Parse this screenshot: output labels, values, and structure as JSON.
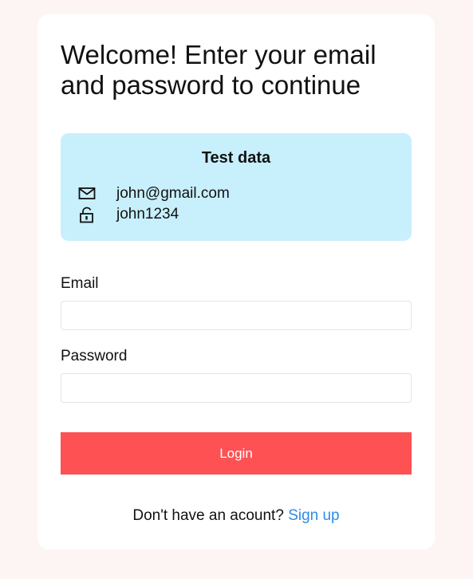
{
  "page": {
    "title": "Welcome! Enter your email and password to continue"
  },
  "test_data": {
    "heading": "Test data",
    "email_icon": "mail-icon",
    "email": "john@gmail.com",
    "password_icon": "lock-icon",
    "password": "john1234"
  },
  "form": {
    "email_label": "Email",
    "email_value": "",
    "password_label": "Password",
    "password_value": "",
    "login_label": "Login"
  },
  "footer": {
    "prompt": "Don't have an acount?",
    "signup_label": "Sign up"
  },
  "colors": {
    "background": "#fdf5f4",
    "card": "#ffffff",
    "test_box": "#c8effc",
    "login_button": "#fd5153",
    "link": "#2e8ce6"
  }
}
